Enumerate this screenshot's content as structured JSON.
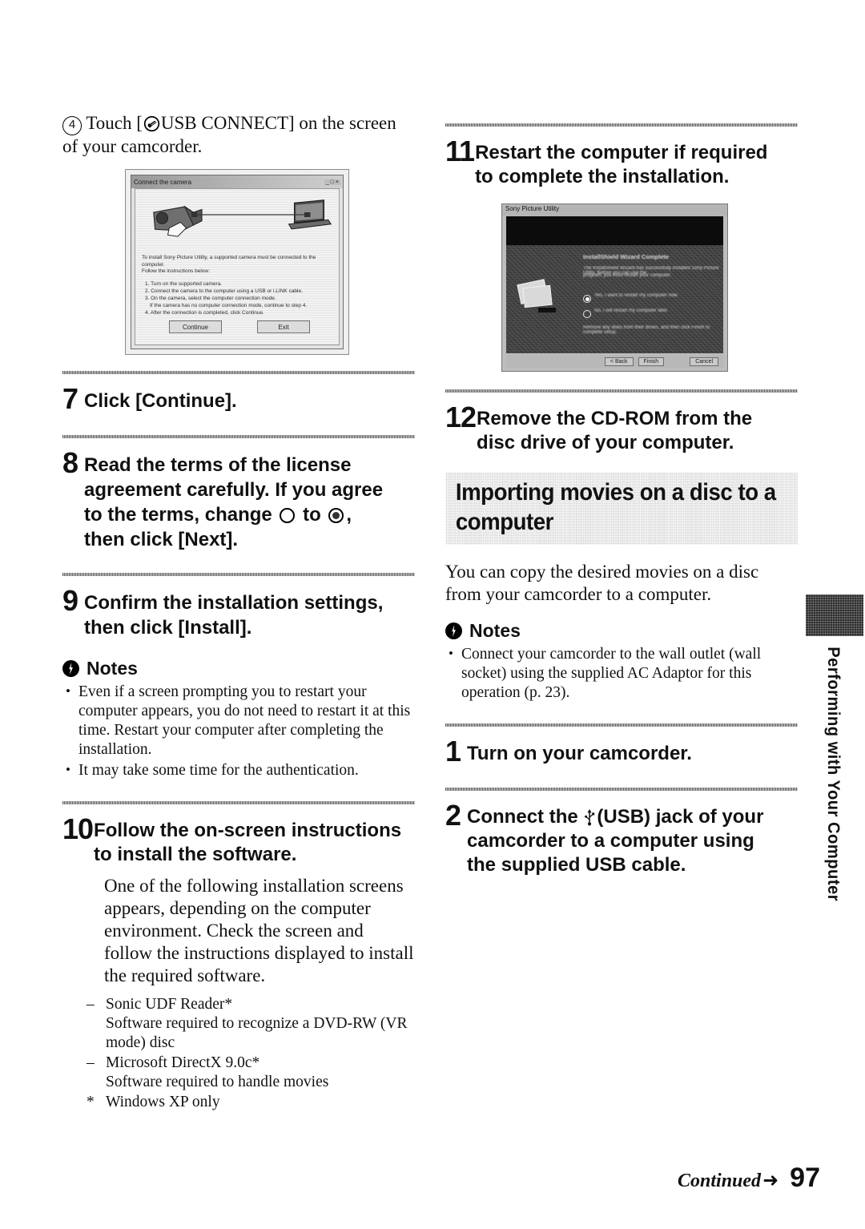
{
  "page": {
    "number": "97",
    "continued_label": "Continued",
    "continued_arrow": "➜",
    "side_tab": "Performing with Your Computer"
  },
  "left_column": {
    "substep": {
      "marker": "4",
      "text_before": "Touch [",
      "icon": "usb-connect-icon",
      "text_after": "USB CONNECT] on the screen of your camcorder."
    },
    "figure_connect": {
      "name": "connect-the-camera-dialog",
      "title": "Connect the camera",
      "intro_line1": "To install Sony Picture Utility, a supported camera must be connected to the",
      "intro_line2": "computer.",
      "intro_line3": "Follow the instructions below:",
      "steps": [
        "1. Turn on the supported camera.",
        "2. Connect the camera to the computer using a USB or i.LINK cable.",
        "3. On the camera, select the computer connection mode.",
        "If the camera has no computer connection mode, continue to step 4.",
        "4. After the connection is completed, click Continue."
      ],
      "buttons": [
        "Continue",
        "Exit"
      ],
      "titlebar_buttons": "_ □ ×"
    },
    "steps": [
      {
        "num": "7",
        "lines": [
          "Click [Continue]."
        ]
      },
      {
        "num": "8",
        "lines": [
          "Read the terms of the license",
          "agreement carefully. If you agree",
          "to the terms, change",
          "then click [Next]."
        ],
        "inline": {
          "to": "to",
          "comma": ","
        }
      },
      {
        "num": "9",
        "lines": [
          "Confirm the installation settings,",
          "then click [Install]."
        ]
      },
      {
        "num": "10",
        "lines": [
          "Follow the on-screen instructions",
          "to install the software."
        ]
      }
    ],
    "notes": {
      "heading": "Notes",
      "items": [
        "Even if a screen prompting you to restart your computer appears, you do not need to restart it at this time. Restart your computer after completing the installation.",
        "It may take some time for the authentication."
      ]
    },
    "step10_body": "One of the following installation screens appears, depending on the computer environment. Check the screen and follow the instructions displayed to install the required software.",
    "software_list": [
      {
        "marker": "–",
        "name": "Sonic UDF Reader*",
        "desc": "Software required to recognize a DVD-RW (VR mode) disc"
      },
      {
        "marker": "–",
        "name": "Microsoft DirectX 9.0c*",
        "desc": "Software required to handle movies"
      }
    ],
    "footnote": {
      "marker": "*",
      "text": "Windows XP only"
    }
  },
  "right_column": {
    "steps": [
      {
        "num": "11",
        "lines": [
          "Restart the computer if required",
          "to complete the installation."
        ]
      },
      {
        "num": "12",
        "lines": [
          "Remove the CD-ROM from the",
          "disc drive of your computer."
        ]
      }
    ],
    "figure_restart": {
      "name": "installshield-wizard-complete-dialog",
      "title": "Sony Picture Utility",
      "heading": "InstallShield Wizard Complete",
      "body_line1": "The InstallShield Wizard has successfully installed Sony Picture Utility. Before you can use the",
      "body_line2": "program, you must restart your computer.",
      "radio_options": [
        {
          "label": "Yes, I want to restart my computer now.",
          "selected": true
        },
        {
          "label": "No, I will restart my computer later.",
          "selected": false
        }
      ],
      "footer_text": "Remove any disks from their drives, and then click Finish to complete setup.",
      "buttons": [
        "< Back",
        "Finish",
        "Cancel"
      ]
    },
    "banner": {
      "line1": "Importing movies on a disc to a",
      "line2": "computer"
    },
    "intro": "You can copy the desired movies on a disc from your camcorder to a computer.",
    "notes": {
      "heading": "Notes",
      "items": [
        "Connect your camcorder to the wall outlet (wall socket) using the supplied AC Adaptor for this operation (p. 23)."
      ]
    },
    "procedure": [
      {
        "num": "1",
        "lines": [
          "Turn on your camcorder."
        ]
      },
      {
        "num": "2",
        "lines": [
          "Connect the",
          "(USB) jack of your",
          "camcorder to a computer using",
          "the supplied USB cable."
        ]
      }
    ]
  },
  "colors": {
    "banner_bg": "#cfcfcf",
    "rule": "#4a4a4a",
    "ink": "#111111"
  }
}
